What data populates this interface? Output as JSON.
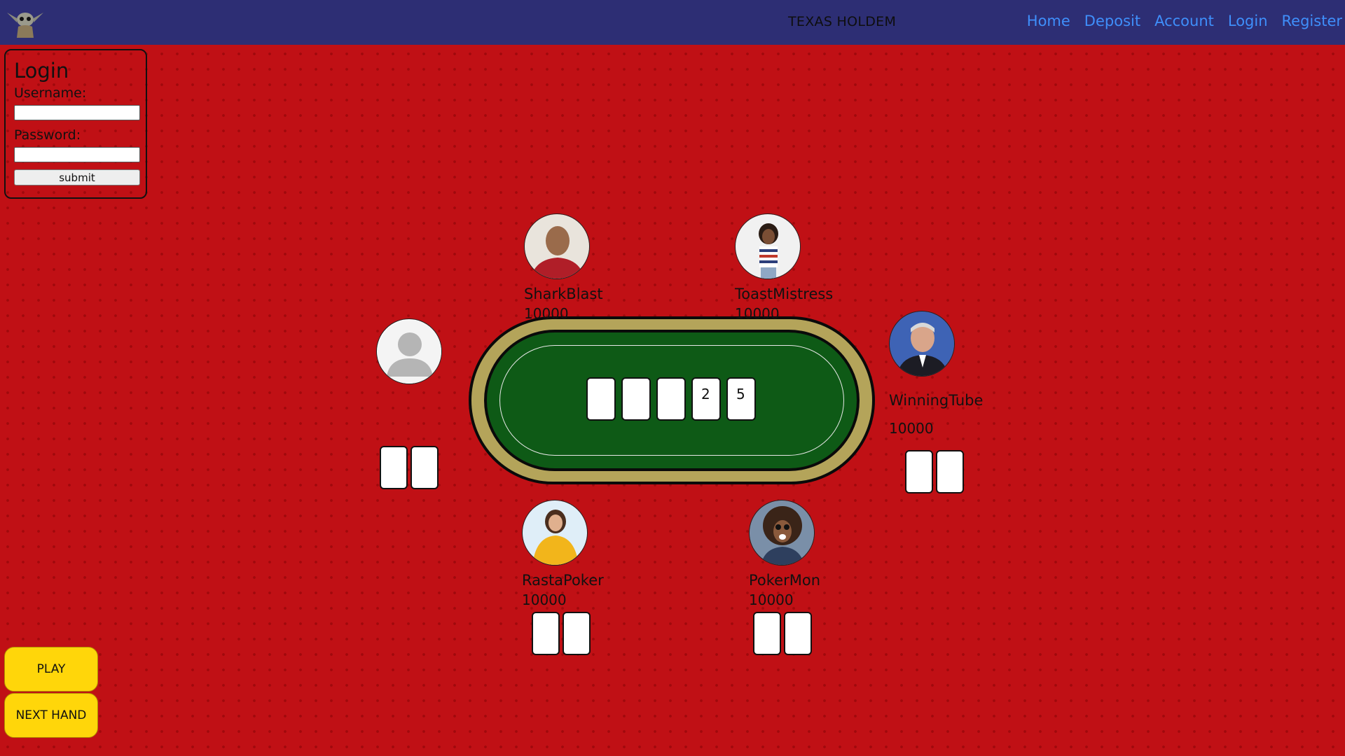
{
  "navbar": {
    "title": "TEXAS HOLDEM",
    "links": [
      "Home",
      "Deposit",
      "Account",
      "Login",
      "Register"
    ]
  },
  "login": {
    "title": "Login",
    "username_label": "Username:",
    "password_label": "Password:",
    "submit_label": "submit",
    "username_value": "",
    "password_value": ""
  },
  "community_cards": [
    "",
    "",
    "",
    "2",
    "5"
  ],
  "players": [
    {
      "name": "SharkBlast",
      "chips": "10000",
      "avatar": "avatar-sharkblast"
    },
    {
      "name": "ToastMistress",
      "chips": "10000",
      "avatar": "avatar-toastmistress"
    },
    {
      "name": "WinningTube",
      "chips": "10000",
      "avatar": "avatar-winningtube"
    },
    {
      "name": "RastaPoker",
      "chips": "10000",
      "avatar": "avatar-rastapoker"
    },
    {
      "name": "PokerMon",
      "chips": "10000",
      "avatar": "avatar-pokermon"
    }
  ],
  "actions": {
    "play": "PLAY",
    "next_hand": "NEXT HAND"
  },
  "colors": {
    "background": "#c01015",
    "navbar": "#2d2e74",
    "link": "#3f8ffb",
    "table_rim": "#b4a45a",
    "table_felt": "#0e5a16",
    "button": "#ffd60a"
  }
}
